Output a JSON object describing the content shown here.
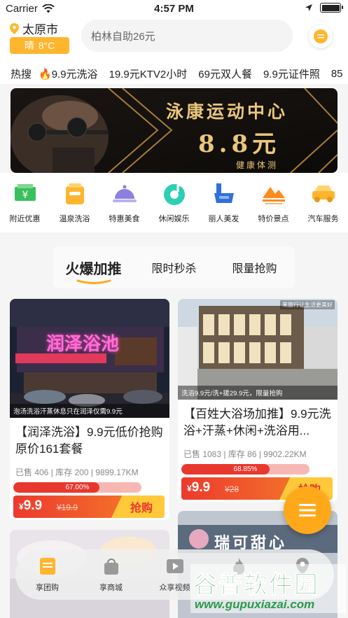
{
  "status_bar": {
    "carrier": "Carrier",
    "time": "4:57 PM"
  },
  "header": {
    "city": "太原市",
    "weather": "晴",
    "temperature": "8°C",
    "search_placeholder": "柏林自助26元"
  },
  "hot_search": {
    "label": "热搜",
    "items": [
      "9.9元洗浴",
      "19.9元KTV2小时",
      "69元双人餐",
      "9.9元证件照",
      "85"
    ]
  },
  "banner": {
    "title": "泳康运动中心",
    "price": "8.8元",
    "subtitle": "健康体测"
  },
  "categories": [
    {
      "label": "附近优惠",
      "icon": "money-icon",
      "color": "#3bbf5a"
    },
    {
      "label": "温泉洗浴",
      "icon": "bath-icon",
      "color": "#ffb52e"
    },
    {
      "label": "特惠美食",
      "icon": "food-cloche-icon",
      "color": "#8b7fe0"
    },
    {
      "label": "休闲娱乐",
      "icon": "music-icon",
      "color": "#2ccfb4"
    },
    {
      "label": "丽人美发",
      "icon": "beauty-icon",
      "color": "#2f6fe0"
    },
    {
      "label": "特价景点",
      "icon": "mountain-icon",
      "color": "#ff8a1e"
    },
    {
      "label": "汽车服务",
      "icon": "car-icon",
      "color": "#ffb52e"
    }
  ],
  "tabs": [
    "火爆加推",
    "限时秒杀",
    "限量抢购"
  ],
  "products": [
    {
      "caption": "泡汤洗浴汗蒸休息只在润泽仅需9.9元",
      "sign": "润泽浴池",
      "title": "【润泽洗浴】9.9元低价抢购原价161套餐",
      "meta": "已售 406 | 库存 200 | 9899.17KM",
      "progress_label": "67.00%",
      "progress": 0.67,
      "currency": "¥",
      "price": "9.9",
      "old_price": "¥19.9",
      "buy_label": "抢购"
    },
    {
      "caption": "洗浴9.9元/洗+搓29.9元，限量抢购",
      "corner_text": "来旅行让生活更美好",
      "title": "【百姓大浴场加推】9.9元洗浴+汗蒸+休闲+洗浴用...",
      "meta": "已售 1083 | 库存 86 | 9902.22KM",
      "progress_label": "68.85%",
      "progress": 0.6885,
      "currency": "¥",
      "price": "9.9",
      "old_price": "¥28",
      "buy_label": "抢购"
    },
    {
      "sign": "瑞可甜心"
    }
  ],
  "tabbar": [
    {
      "label": "享团购",
      "icon": "group-buy-icon"
    },
    {
      "label": "享商城",
      "icon": "shopping-bag-icon"
    },
    {
      "label": "众享视频",
      "icon": "video-icon"
    },
    {
      "label": "",
      "icon": "fire-icon"
    },
    {
      "label": "",
      "icon": "location-icon"
    }
  ],
  "watermark": {
    "title": "谷普软件园",
    "url": "www.gupuxiazai.com"
  }
}
